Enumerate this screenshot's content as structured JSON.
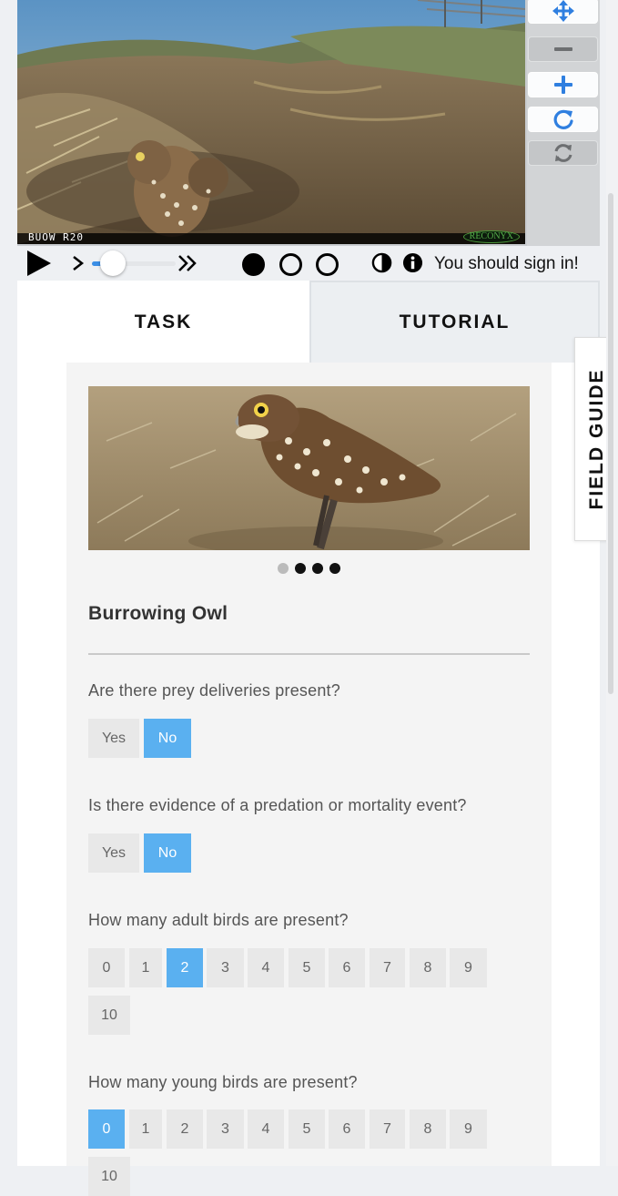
{
  "viewer": {
    "stamp_left": "BUOW R20",
    "stamp_right": "RECONYX",
    "zoom_buttons": [
      {
        "icon": "move-arrows-icon",
        "enabled": true
      },
      {
        "icon": "zoom-out-minus-icon",
        "enabled": false
      },
      {
        "icon": "zoom-in-plus-icon",
        "enabled": true
      },
      {
        "icon": "rotate-icon",
        "enabled": true
      },
      {
        "icon": "reset-refresh-icon",
        "enabled": false
      }
    ]
  },
  "controls": {
    "play_icon": "play-icon",
    "slow_icon": "chevron-right-icon",
    "fast_icon": "double-chevron-right-icon",
    "speed_fraction": 0.25,
    "frame_dots": [
      true,
      false,
      false
    ],
    "contrast_icon": "contrast-icon",
    "info_icon": "info-icon",
    "signin_text": "You should sign in!"
  },
  "tabs": {
    "task": "TASK",
    "tutorial": "TUTORIAL"
  },
  "field_guide": {
    "label": "FIELD GUIDE"
  },
  "task": {
    "carousel_dots": [
      false,
      true,
      true,
      true
    ],
    "species": "Burrowing Owl",
    "questions": [
      {
        "text": "Are there prey deliveries present?",
        "options": [
          "Yes",
          "No"
        ],
        "selected": "No"
      },
      {
        "text": "Is there evidence of a predation or mortality event?",
        "options": [
          "Yes",
          "No"
        ],
        "selected": "No"
      },
      {
        "text": "How many adult birds are present?",
        "options": [
          "0",
          "1",
          "2",
          "3",
          "4",
          "5",
          "6",
          "7",
          "8",
          "9",
          "10"
        ],
        "selected": "2"
      },
      {
        "text": "How many young birds are present?",
        "options": [
          "0",
          "1",
          "2",
          "3",
          "4",
          "5",
          "6",
          "7",
          "8",
          "9",
          "10"
        ],
        "selected": "0"
      }
    ]
  },
  "colors": {
    "accent": "#5ab0f0",
    "zoom_icon": "#2f7fe0",
    "panel_bg": "#f4f4f4"
  }
}
